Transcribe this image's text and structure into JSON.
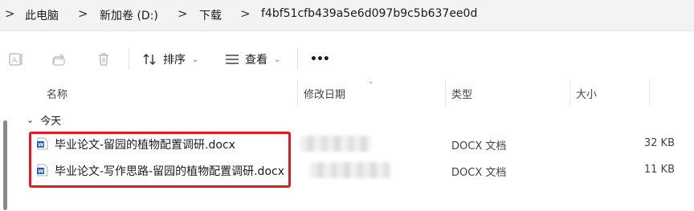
{
  "breadcrumb": {
    "items": [
      "此电脑",
      "新加卷 (D:)",
      "下载",
      "f4bf51cfb439a5e6d097b9c5b637ee0d"
    ],
    "separator": ">"
  },
  "commandbar": {
    "sort_label": "排序",
    "view_label": "查看",
    "more_label": "•••"
  },
  "columns": {
    "name": "名称",
    "modified": "修改日期",
    "type": "类型",
    "size": "大小"
  },
  "group": {
    "label": "今天"
  },
  "files": [
    {
      "name": "毕业论文-留园的植物配置调研.docx",
      "modified": "",
      "type": "DOCX 文档",
      "size": "32 KB"
    },
    {
      "name": "毕业论文-写作思路-留园的植物配置调研.docx",
      "modified": "",
      "type": "DOCX 文档",
      "size": "11 KB"
    }
  ],
  "colors": {
    "highlight": "#e01b23",
    "word_icon": "#185abd"
  },
  "icons": {
    "rename": "rename-icon",
    "share": "share-icon",
    "delete": "delete-icon",
    "sort": "sort-icon",
    "view": "view-icon",
    "file": "word-file-icon"
  }
}
